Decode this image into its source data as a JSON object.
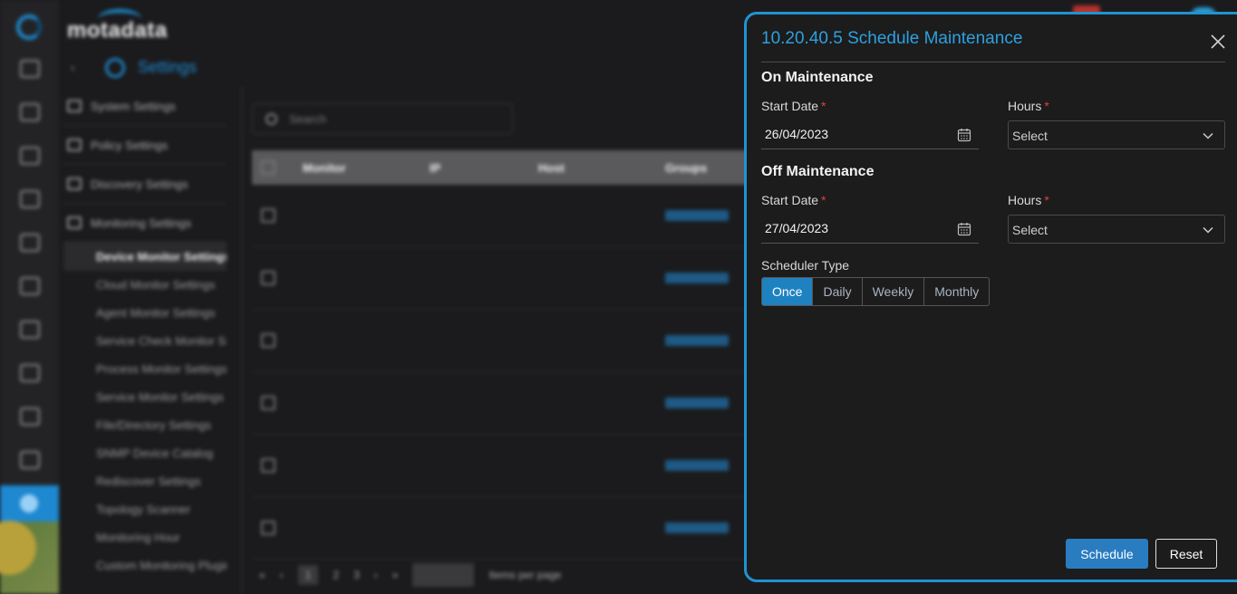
{
  "app": {
    "brand": "motadata",
    "section_title": "Settings",
    "search_placeholder": "Search",
    "side_groups": [
      "System Settings",
      "Policy Settings",
      "Discovery Settings",
      "Monitoring Settings"
    ],
    "side_items": [
      "Device Monitor Settings",
      "Cloud Monitor Settings",
      "Agent Monitor Settings",
      "Service Check Monitor Settings",
      "Process Monitor Settings",
      "Service Monitor Settings",
      "File/Directory Settings",
      "SNMP Device Catalog",
      "Rediscover Settings",
      "Topology Scanner",
      "Monitoring Hour",
      "Custom Monitoring Plugin"
    ],
    "table_headers": [
      "Monitor",
      "IP",
      "Host",
      "Groups"
    ],
    "pager_pages": [
      "1",
      "2",
      "3"
    ],
    "per_page_label": "Items per page"
  },
  "drawer": {
    "title": "10.20.40.5 Schedule Maintenance",
    "on_maintenance": {
      "heading": "On Maintenance",
      "start_date_label": "Start Date",
      "start_date_value": "26/04/2023",
      "hours_label": "Hours",
      "hours_value": "Select"
    },
    "off_maintenance": {
      "heading": "Off Maintenance",
      "start_date_label": "Start Date",
      "start_date_value": "27/04/2023",
      "hours_label": "Hours",
      "hours_value": "Select"
    },
    "scheduler_type": {
      "label": "Scheduler Type",
      "options": [
        "Once",
        "Daily",
        "Weekly",
        "Monthly"
      ],
      "selected": "Once"
    },
    "schedule_button": "Schedule",
    "reset_button": "Reset",
    "required_mark": "*"
  },
  "colors": {
    "accent": "#1f93d4",
    "selected_segment": "#1f82c0",
    "primary_button": "#2a7cc0",
    "required": "#e0413a"
  }
}
